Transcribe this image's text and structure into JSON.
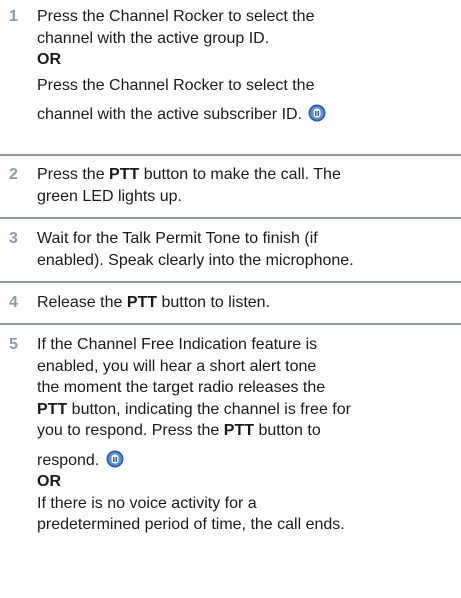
{
  "colors": {
    "step_number": "#8a9aac",
    "divider": "#8a9aac",
    "icon": "#2a5fa8"
  },
  "icons": {
    "radio": "radio-feature-icon"
  },
  "steps": [
    {
      "number": "1",
      "line1": "Press the Channel Rocker to select the",
      "line2": "channel with the active group ID.",
      "or": "OR",
      "line3": "Press the Channel Rocker to select the",
      "line4": "channel with the active subscriber ID."
    },
    {
      "number": "2",
      "pre": "Press the ",
      "kw": "PTT",
      "post": " button to make the call. The",
      "line2": "green LED lights up."
    },
    {
      "number": "3",
      "line1": "Wait for the Talk Permit Tone to finish (if",
      "line2": "enabled). Speak clearly into the microphone."
    },
    {
      "number": "4",
      "pre": "Release the ",
      "kw": "PTT",
      "post": " button to listen."
    },
    {
      "number": "5",
      "line1": "If the Channel Free Indication feature is",
      "line2": "enabled, you will hear a short alert tone",
      "line3": "the moment the target radio releases the",
      "line4_kw": "PTT",
      "line4_post": " button, indicating the channel is free for",
      "line5_pre": "you to respond. Press the ",
      "line5_kw": "PTT",
      "line5_post": " button to",
      "line6": "respond.",
      "or": "OR",
      "line7": "If there is no voice activity for a",
      "line8": "predetermined period of time, the call ends."
    }
  ]
}
